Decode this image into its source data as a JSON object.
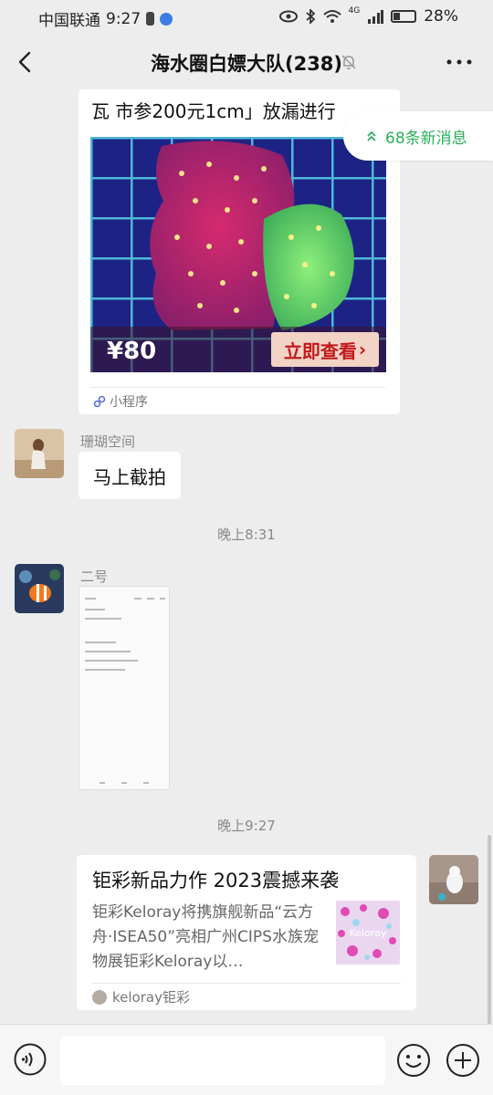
{
  "status_bar": {
    "carrier": "中国联通",
    "time": "9:27",
    "network_label": "4G",
    "battery": "28%"
  },
  "nav": {
    "title": "海水圈白嫖大队(238)"
  },
  "new_messages": {
    "label": "68条新消息"
  },
  "mini_program": {
    "title": "瓦 市参200元1cm」放漏进行",
    "price": "¥80",
    "view_button": "立即查看",
    "footer": "小程序"
  },
  "messages": [
    {
      "sender": "珊瑚空间",
      "text": "马上截拍"
    },
    {
      "sender": "二号"
    }
  ],
  "time_labels": [
    "晚上8:31",
    "晚上9:27"
  ],
  "link_card": {
    "title": "钜彩新品力作 2023震撼来袭",
    "description": "钜彩Keloray将携旗舰新品“云方舟·ISEA50”亮相广州CIPS水族宠物展钜彩Keloray以…",
    "source": "keloray钜彩",
    "thumb_text": "Keloray"
  },
  "input_bar": {
    "placeholder": ""
  },
  "colors": {
    "accent_green": "#29b05a",
    "price_button_text": "#c2191c",
    "background": "#ededed"
  }
}
